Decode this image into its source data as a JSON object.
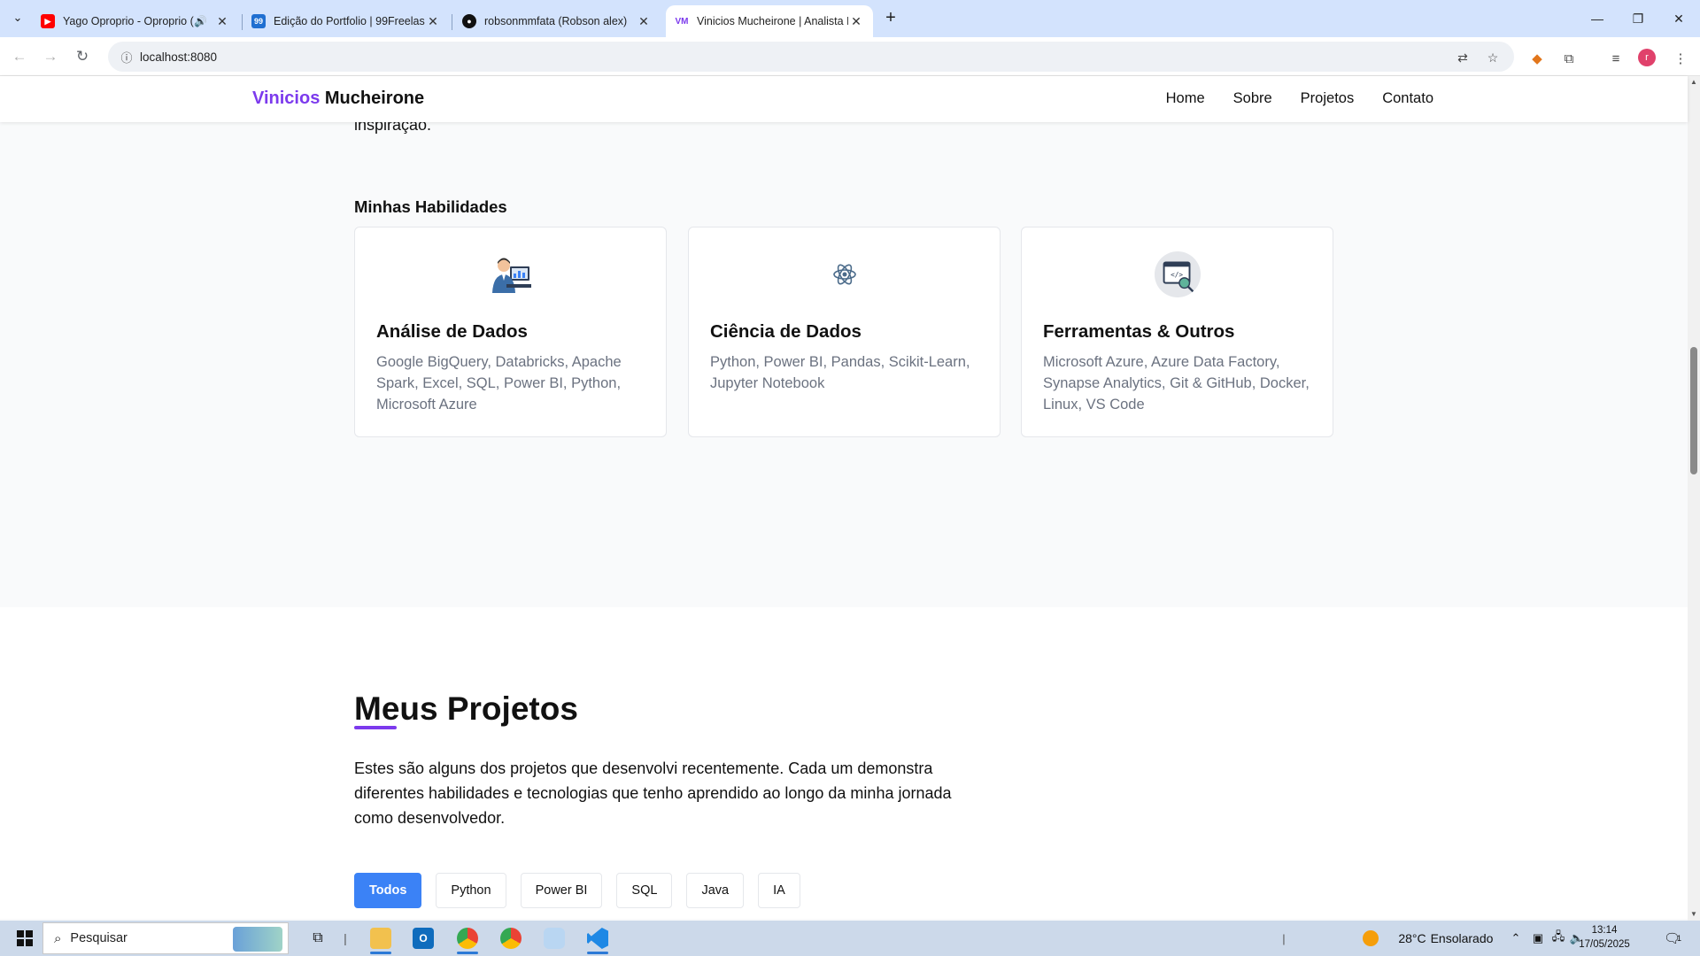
{
  "browser": {
    "tabs": [
      {
        "title": "Yago Oproprio - Oproprio (",
        "favicon": "youtube-icon",
        "color": "#ff0000",
        "audio": true,
        "active": false
      },
      {
        "title": "Edição do Portfolio | 99Freelas",
        "favicon": "99freelas-icon",
        "color": "#1f6fd1",
        "audio": false,
        "active": false
      },
      {
        "title": "robsonmmfata (Robson alex)",
        "favicon": "github-icon",
        "color": "#111111",
        "audio": false,
        "active": false
      },
      {
        "title": "Vinicios Mucheirone | Analista D",
        "favicon": "vm-icon",
        "color": "#7c3aed",
        "audio": false,
        "active": true
      }
    ],
    "url": "localhost:8080",
    "profile_initial": "r"
  },
  "site": {
    "logo_first": "Vinicios",
    "logo_last": "Mucheirone",
    "nav": [
      "Home",
      "Sobre",
      "Projetos",
      "Contato"
    ]
  },
  "about": {
    "cutoff_text": "inspiração."
  },
  "skills": {
    "title": "Minhas Habilidades",
    "cards": [
      {
        "title": "Análise de Dados",
        "text": "Google BigQuery, Databricks, Apache Spark, Excel, SQL, Power BI, Python, Microsoft Azure",
        "icon": "data-analyst-icon"
      },
      {
        "title": "Ciência de Dados",
        "text": "Python, Power BI, Pandas, Scikit-Learn, Jupyter Notebook",
        "icon": "atom-icon"
      },
      {
        "title": "Ferramentas & Outros",
        "text": "Microsoft Azure, Azure Data Factory, Synapse Analytics, Git & GitHub, Docker, Linux, VS Code",
        "icon": "code-window-icon"
      }
    ]
  },
  "projects": {
    "title": "Meus Projetos",
    "description": "Estes são alguns dos projetos que desenvolvi recentemente. Cada um demonstra diferentes habilidades e tecnologias que tenho aprendido ao longo da minha jornada como desenvolvedor.",
    "filters": [
      "Todos",
      "Python",
      "Power BI",
      "SQL",
      "Java",
      "IA"
    ],
    "active_filter": "Todos"
  },
  "taskbar": {
    "search_placeholder": "Pesquisar",
    "weather_temp": "28°C",
    "weather_desc": "Ensolarado",
    "time": "13:14",
    "date": "17/05/2025",
    "notification_count": "1"
  },
  "colors": {
    "accent": "#7c3aed",
    "button_active": "#3b82f6"
  }
}
